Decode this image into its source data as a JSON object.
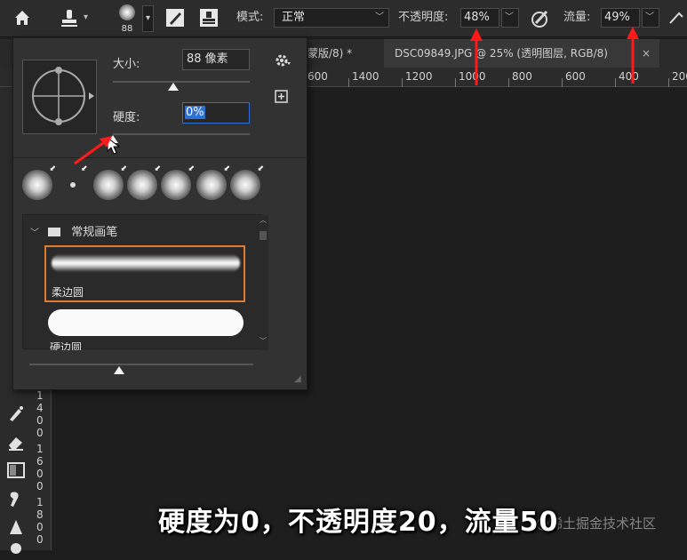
{
  "toolbar": {
    "brush_size_value": "88",
    "mode_label": "模式:",
    "mode_value": "正常",
    "opacity_label": "不透明度:",
    "opacity_value": "48%",
    "flow_label": "流量:",
    "flow_value": "49%"
  },
  "tabs": [
    {
      "label": "蒙版/8) *"
    },
    {
      "label": "DSC09849.JPG @ 25% (透明图层, RGB/8)"
    }
  ],
  "ruler_h": [
    "600",
    "1400",
    "1200",
    "1000",
    "800",
    "600",
    "400",
    "200"
  ],
  "ruler_v": [
    "1",
    "4",
    "0",
    "0",
    "1",
    "6",
    "0",
    "0",
    "1",
    "8",
    "0",
    "0"
  ],
  "brush_panel": {
    "size_label": "大小:",
    "size_value": "88 像素",
    "size_slider_fraction": 0.44,
    "hardness_label": "硬度:",
    "hardness_value": "0%",
    "hardness_slider_fraction": 0.0,
    "group_name": "常规画笔",
    "brushes": [
      {
        "name": "柔边圆",
        "selected": true
      },
      {
        "name": "硬边圆",
        "selected": false
      }
    ],
    "preview_slider_fraction": 0.4
  },
  "caption": "硬度为0，不透明度20，流量50",
  "watermark": "@稀土掘金技术社区",
  "colors": {
    "accent_orange": "#e07a2c",
    "arrow_red": "#ff1a1a",
    "input_blue": "#2d6fd2"
  }
}
